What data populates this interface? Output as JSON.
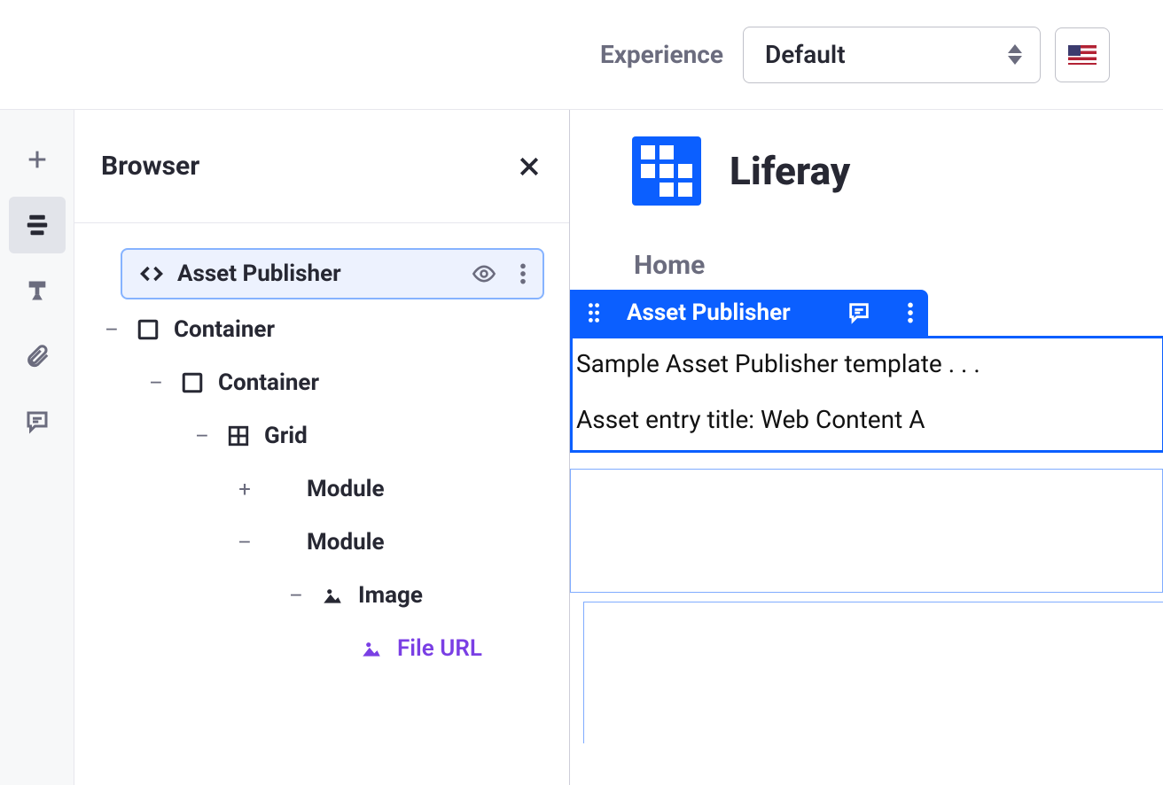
{
  "topbar": {
    "experience_label": "Experience",
    "experience_value": "Default"
  },
  "rail": {
    "items": [
      "add",
      "browser",
      "brush",
      "attachment",
      "comments"
    ]
  },
  "browser": {
    "title": "Browser",
    "selected": {
      "label": "Asset Publisher"
    },
    "tree": [
      {
        "label": "Container",
        "indent": 1,
        "expander": "-",
        "icon": "square"
      },
      {
        "label": "Container",
        "indent": 2,
        "expander": "-",
        "icon": "square"
      },
      {
        "label": "Grid",
        "indent": 3,
        "expander": "-",
        "icon": "grid"
      },
      {
        "label": "Module",
        "indent": 4,
        "expander": "+",
        "icon": ""
      },
      {
        "label": "Module",
        "indent": 4,
        "expander": "-",
        "icon": ""
      },
      {
        "label": "Image",
        "indent": 5,
        "expander": "-",
        "icon": "image"
      },
      {
        "label": "File URL",
        "indent": 6,
        "expander": "",
        "icon": "image-purple",
        "link": true
      }
    ]
  },
  "canvas": {
    "brand": "Liferay",
    "breadcrumb": "Home",
    "widget": {
      "title": "Asset Publisher",
      "line1": "Sample Asset Publisher template . . .",
      "line2": "Asset entry title: Web Content A"
    }
  }
}
